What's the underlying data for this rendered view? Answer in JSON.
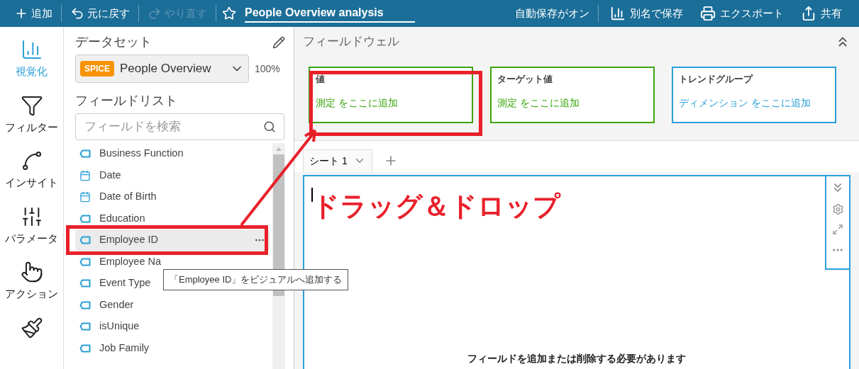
{
  "toolbar": {
    "items": [
      {
        "kind": "add",
        "label": "追加",
        "disabled": false
      },
      {
        "kind": "undo",
        "label": "元に戻す",
        "disabled": false
      },
      {
        "kind": "redo",
        "label": "やり直す",
        "disabled": true
      }
    ],
    "title": "People Overview analysis",
    "autosave": "自動保存がオン",
    "actions": [
      {
        "kind": "save-as",
        "label": "別名で保存"
      },
      {
        "kind": "export",
        "label": "エクスポート"
      },
      {
        "kind": "share",
        "label": "共有"
      }
    ]
  },
  "rail": [
    {
      "kind": "visualize",
      "label": "視覚化",
      "selected": true
    },
    {
      "kind": "filter",
      "label": "フィルター",
      "selected": false
    },
    {
      "kind": "insight",
      "label": "インサイト",
      "selected": false
    },
    {
      "kind": "parameter",
      "label": "パラメータ",
      "selected": false
    },
    {
      "kind": "action",
      "label": "アクション",
      "selected": false
    },
    {
      "kind": "format",
      "selected": false
    }
  ],
  "dataset": {
    "heading": "データセット",
    "badge": "SPICE",
    "name": "People Overview",
    "percent": "100%"
  },
  "field_list": {
    "heading": "フィールドリスト",
    "placeholder": "フィールドを検索",
    "items": [
      {
        "name": "Business Function",
        "kind": "dimension",
        "selected": false
      },
      {
        "name": "Date",
        "kind": "date",
        "selected": false
      },
      {
        "name": "Date of Birth",
        "kind": "date",
        "selected": false
      },
      {
        "name": "Education",
        "kind": "dimension",
        "selected": false
      },
      {
        "name": "Employee ID",
        "kind": "dimension",
        "selected": true
      },
      {
        "name": "Employee Na",
        "kind": "dimension",
        "selected": false
      },
      {
        "name": "Event Type",
        "kind": "dimension",
        "selected": false
      },
      {
        "name": "Gender",
        "kind": "dimension",
        "selected": false
      },
      {
        "name": "isUnique",
        "kind": "dimension",
        "selected": false
      },
      {
        "name": "Job Family",
        "kind": "dimension",
        "selected": false
      }
    ]
  },
  "tooltip": "「Employee ID」をビジュアルへ追加する",
  "field_wells": {
    "title": "フィールドウェル",
    "wells": [
      {
        "label": "値",
        "hint": "測定 をここに追加",
        "kind": "measure"
      },
      {
        "label": "ターゲット値",
        "hint": "測定 をここに追加",
        "kind": "measure"
      },
      {
        "label": "トレンドグループ",
        "hint": "ディメンション をここに追加",
        "kind": "dimension"
      }
    ]
  },
  "sheet_tab": "シート 1",
  "visual": {
    "message": "フィールドを追加または削除する必要があります"
  },
  "annotation": "ドラッグ＆ドロップ"
}
